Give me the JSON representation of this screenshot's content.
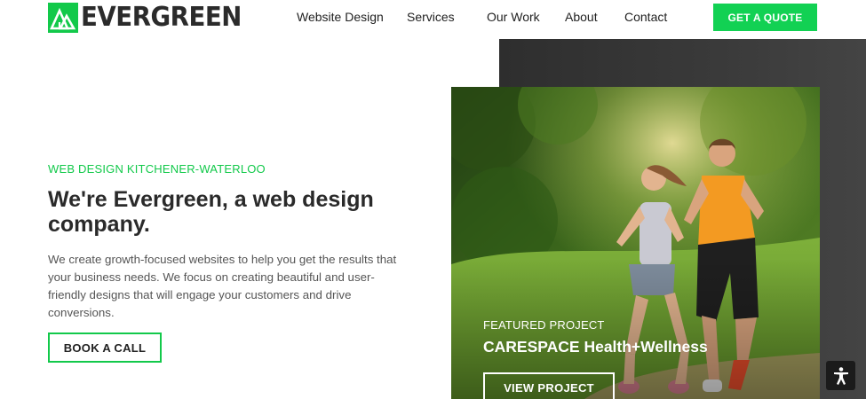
{
  "brand": {
    "name": "EVERGREEN",
    "accent": "#12c94a"
  },
  "nav": {
    "items": [
      {
        "label": "Website Design"
      },
      {
        "label": "Services"
      },
      {
        "label": "Our Work"
      },
      {
        "label": "About"
      },
      {
        "label": "Contact"
      }
    ],
    "cta_label": "GET A QUOTE"
  },
  "hero": {
    "eyebrow": "WEB DESIGN KITCHENER-WATERLOO",
    "headline": "We're Evergreen, a web design company.",
    "description": "We create growth-focused websites to help you get the results that your business needs. We focus on creating beautiful and user-friendly designs that will engage your customers and drive conversions.",
    "button_label": "BOOK A CALL"
  },
  "featured": {
    "label": "FEATURED PROJECT",
    "title": "CARESPACE Health+Wellness",
    "button_label": "VIEW PROJECT"
  },
  "accessibility": {
    "icon": "accessibility-icon"
  }
}
